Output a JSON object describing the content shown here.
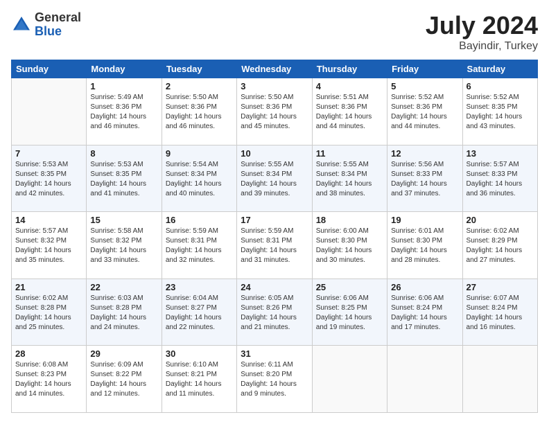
{
  "logo": {
    "general": "General",
    "blue": "Blue"
  },
  "header": {
    "month": "July 2024",
    "location": "Bayindir, Turkey"
  },
  "days": [
    "Sunday",
    "Monday",
    "Tuesday",
    "Wednesday",
    "Thursday",
    "Friday",
    "Saturday"
  ],
  "weeks": [
    [
      {
        "day": "",
        "info": ""
      },
      {
        "day": "1",
        "info": "Sunrise: 5:49 AM\nSunset: 8:36 PM\nDaylight: 14 hours\nand 46 minutes."
      },
      {
        "day": "2",
        "info": "Sunrise: 5:50 AM\nSunset: 8:36 PM\nDaylight: 14 hours\nand 46 minutes."
      },
      {
        "day": "3",
        "info": "Sunrise: 5:50 AM\nSunset: 8:36 PM\nDaylight: 14 hours\nand 45 minutes."
      },
      {
        "day": "4",
        "info": "Sunrise: 5:51 AM\nSunset: 8:36 PM\nDaylight: 14 hours\nand 44 minutes."
      },
      {
        "day": "5",
        "info": "Sunrise: 5:52 AM\nSunset: 8:36 PM\nDaylight: 14 hours\nand 44 minutes."
      },
      {
        "day": "6",
        "info": "Sunrise: 5:52 AM\nSunset: 8:35 PM\nDaylight: 14 hours\nand 43 minutes."
      }
    ],
    [
      {
        "day": "7",
        "info": "Sunrise: 5:53 AM\nSunset: 8:35 PM\nDaylight: 14 hours\nand 42 minutes."
      },
      {
        "day": "8",
        "info": "Sunrise: 5:53 AM\nSunset: 8:35 PM\nDaylight: 14 hours\nand 41 minutes."
      },
      {
        "day": "9",
        "info": "Sunrise: 5:54 AM\nSunset: 8:34 PM\nDaylight: 14 hours\nand 40 minutes."
      },
      {
        "day": "10",
        "info": "Sunrise: 5:55 AM\nSunset: 8:34 PM\nDaylight: 14 hours\nand 39 minutes."
      },
      {
        "day": "11",
        "info": "Sunrise: 5:55 AM\nSunset: 8:34 PM\nDaylight: 14 hours\nand 38 minutes."
      },
      {
        "day": "12",
        "info": "Sunrise: 5:56 AM\nSunset: 8:33 PM\nDaylight: 14 hours\nand 37 minutes."
      },
      {
        "day": "13",
        "info": "Sunrise: 5:57 AM\nSunset: 8:33 PM\nDaylight: 14 hours\nand 36 minutes."
      }
    ],
    [
      {
        "day": "14",
        "info": "Sunrise: 5:57 AM\nSunset: 8:32 PM\nDaylight: 14 hours\nand 35 minutes."
      },
      {
        "day": "15",
        "info": "Sunrise: 5:58 AM\nSunset: 8:32 PM\nDaylight: 14 hours\nand 33 minutes."
      },
      {
        "day": "16",
        "info": "Sunrise: 5:59 AM\nSunset: 8:31 PM\nDaylight: 14 hours\nand 32 minutes."
      },
      {
        "day": "17",
        "info": "Sunrise: 5:59 AM\nSunset: 8:31 PM\nDaylight: 14 hours\nand 31 minutes."
      },
      {
        "day": "18",
        "info": "Sunrise: 6:00 AM\nSunset: 8:30 PM\nDaylight: 14 hours\nand 30 minutes."
      },
      {
        "day": "19",
        "info": "Sunrise: 6:01 AM\nSunset: 8:30 PM\nDaylight: 14 hours\nand 28 minutes."
      },
      {
        "day": "20",
        "info": "Sunrise: 6:02 AM\nSunset: 8:29 PM\nDaylight: 14 hours\nand 27 minutes."
      }
    ],
    [
      {
        "day": "21",
        "info": "Sunrise: 6:02 AM\nSunset: 8:28 PM\nDaylight: 14 hours\nand 25 minutes."
      },
      {
        "day": "22",
        "info": "Sunrise: 6:03 AM\nSunset: 8:28 PM\nDaylight: 14 hours\nand 24 minutes."
      },
      {
        "day": "23",
        "info": "Sunrise: 6:04 AM\nSunset: 8:27 PM\nDaylight: 14 hours\nand 22 minutes."
      },
      {
        "day": "24",
        "info": "Sunrise: 6:05 AM\nSunset: 8:26 PM\nDaylight: 14 hours\nand 21 minutes."
      },
      {
        "day": "25",
        "info": "Sunrise: 6:06 AM\nSunset: 8:25 PM\nDaylight: 14 hours\nand 19 minutes."
      },
      {
        "day": "26",
        "info": "Sunrise: 6:06 AM\nSunset: 8:24 PM\nDaylight: 14 hours\nand 17 minutes."
      },
      {
        "day": "27",
        "info": "Sunrise: 6:07 AM\nSunset: 8:24 PM\nDaylight: 14 hours\nand 16 minutes."
      }
    ],
    [
      {
        "day": "28",
        "info": "Sunrise: 6:08 AM\nSunset: 8:23 PM\nDaylight: 14 hours\nand 14 minutes."
      },
      {
        "day": "29",
        "info": "Sunrise: 6:09 AM\nSunset: 8:22 PM\nDaylight: 14 hours\nand 12 minutes."
      },
      {
        "day": "30",
        "info": "Sunrise: 6:10 AM\nSunset: 8:21 PM\nDaylight: 14 hours\nand 11 minutes."
      },
      {
        "day": "31",
        "info": "Sunrise: 6:11 AM\nSunset: 8:20 PM\nDaylight: 14 hours\nand 9 minutes."
      },
      {
        "day": "",
        "info": ""
      },
      {
        "day": "",
        "info": ""
      },
      {
        "day": "",
        "info": ""
      }
    ]
  ]
}
